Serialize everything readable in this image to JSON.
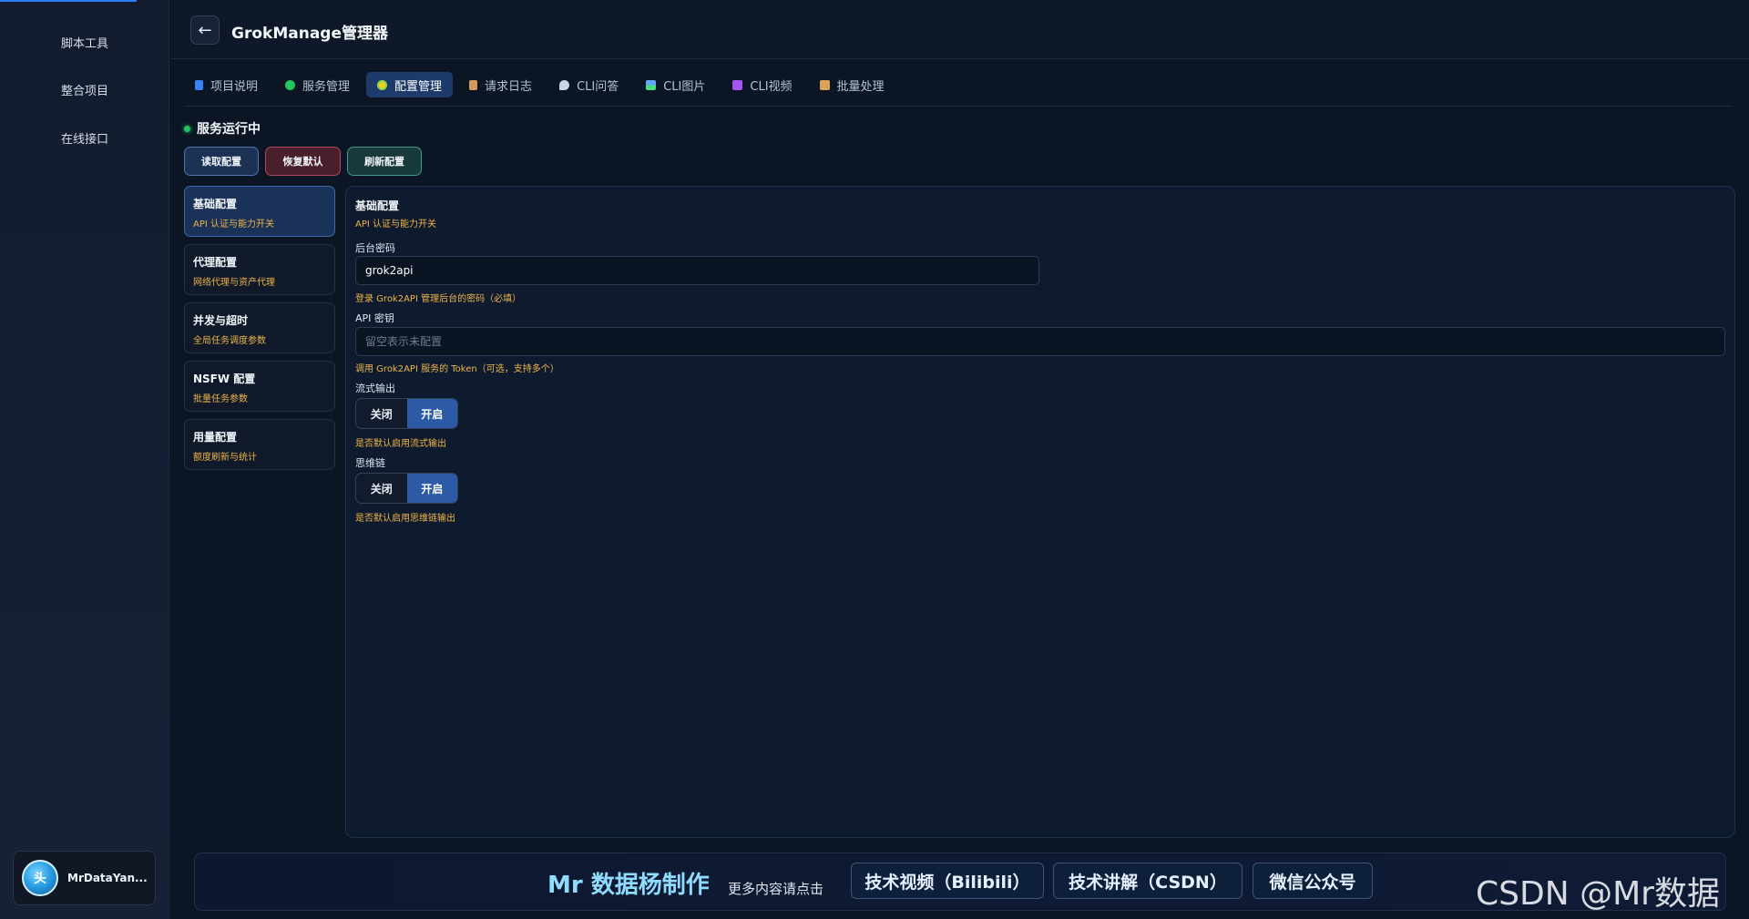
{
  "sidebar": {
    "items": [
      {
        "label": "脚本工具"
      },
      {
        "label": "整合项目"
      },
      {
        "label": "在线接口"
      }
    ],
    "user": {
      "avatar_text": "头",
      "name": "MrDataYan..."
    }
  },
  "header": {
    "title": "GrokManage管理器"
  },
  "tabs": [
    {
      "label": "项目说明",
      "icon": "book-icon",
      "color": "#3b82f6"
    },
    {
      "label": "服务管理",
      "icon": "circle-icon",
      "color": "#22c55e"
    },
    {
      "label": "配置管理",
      "icon": "gear-icon",
      "color": "#facc15"
    },
    {
      "label": "请求日志",
      "icon": "scroll-icon",
      "color": "#d39a5c"
    },
    {
      "label": "CLI问答",
      "icon": "chat-bubble-icon",
      "color": "#cbd5e1"
    },
    {
      "label": "CLI图片",
      "icon": "image-icon",
      "color": "#4ade80"
    },
    {
      "label": "CLI视频",
      "icon": "film-icon",
      "color": "#a855f7"
    },
    {
      "label": "批量处理",
      "icon": "package-icon",
      "color": "#d9a35b"
    }
  ],
  "status": {
    "text": "服务运行中"
  },
  "actions": {
    "read": "读取配置",
    "reset": "恢复默认",
    "refresh": "刷新配置"
  },
  "config_nav": [
    {
      "title": "基础配置",
      "sub": "API 认证与能力开关"
    },
    {
      "title": "代理配置",
      "sub": "网络代理与资产代理"
    },
    {
      "title": "并发与超时",
      "sub": "全局任务调度参数"
    },
    {
      "title": "NSFW 配置",
      "sub": "批量任务参数"
    },
    {
      "title": "用量配置",
      "sub": "额度刷新与统计"
    }
  ],
  "panel": {
    "title": "基础配置",
    "subtitle": "API 认证与能力开关",
    "fields": {
      "admin_password": {
        "label": "后台密码",
        "value": "grok2api",
        "hint": "登录 Grok2API 管理后台的密码（必填）"
      },
      "api_key": {
        "label": "API 密钥",
        "placeholder": "留空表示未配置",
        "hint": "调用 Grok2API 服务的 Token（可选，支持多个）"
      },
      "stream": {
        "label": "流式输出",
        "off": "关闭",
        "on": "开启",
        "selected": "开启",
        "hint": "是否默认启用流式输出"
      },
      "thinking": {
        "label": "思维链",
        "off": "关闭",
        "on": "开启",
        "selected": "开启",
        "hint": "是否默认启用思维链输出"
      }
    }
  },
  "banner": {
    "main": "Mr 数据杨制作",
    "more": "更多内容请点击",
    "links": [
      "技术视频（Bilibili）",
      "技术讲解（CSDN）",
      "微信公众号"
    ]
  },
  "watermark": "CSDN @Mr数据杨"
}
